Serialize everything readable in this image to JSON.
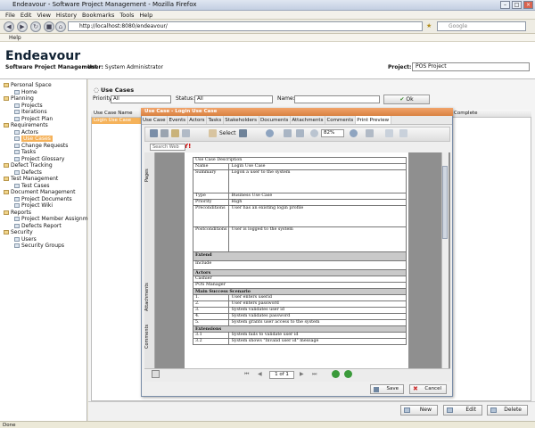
{
  "browser": {
    "title": "Endeavour - Software Project Management - Mozilla Firefox",
    "menu": [
      "File",
      "Edit",
      "View",
      "History",
      "Bookmarks",
      "Tools",
      "Help"
    ],
    "url": "http://localhost:8080/endeavour/",
    "search_placeholder": "Google",
    "help_label": "Help"
  },
  "app": {
    "logo": "Endeavour",
    "subtitle": "Software Project Management",
    "user_label": "User:",
    "user_value": "System Administrator",
    "project_label": "Project:",
    "project_value": "POS Project"
  },
  "sidebar": {
    "items": [
      {
        "label": "Personal Space",
        "level": 0
      },
      {
        "label": "Home",
        "level": 1
      },
      {
        "label": "Planning",
        "level": 0
      },
      {
        "label": "Projects",
        "level": 1
      },
      {
        "label": "Iterations",
        "level": 1
      },
      {
        "label": "Project Plan",
        "level": 1
      },
      {
        "label": "Requirements",
        "level": 0
      },
      {
        "label": "Actors",
        "level": 1
      },
      {
        "label": "Use Cases",
        "level": 1,
        "selected": true
      },
      {
        "label": "Change Requests",
        "level": 1
      },
      {
        "label": "Tasks",
        "level": 1
      },
      {
        "label": "Project Glossary",
        "level": 1
      },
      {
        "label": "Defect Tracking",
        "level": 0
      },
      {
        "label": "Defects",
        "level": 1
      },
      {
        "label": "Test Management",
        "level": 0
      },
      {
        "label": "Test Cases",
        "level": 1
      },
      {
        "label": "Document Management",
        "level": 0
      },
      {
        "label": "Project Documents",
        "level": 1
      },
      {
        "label": "Project Wiki",
        "level": 1
      },
      {
        "label": "Reports",
        "level": 0
      },
      {
        "label": "Project Member Assignments",
        "level": 1
      },
      {
        "label": "Defects Report",
        "level": 1
      },
      {
        "label": "Security",
        "level": 0
      },
      {
        "label": "Users",
        "level": 1
      },
      {
        "label": "Security Groups",
        "level": 1
      }
    ]
  },
  "main": {
    "title": "Use Cases",
    "priority_label": "Priority:",
    "priority_value": "All",
    "status_label": "Status:",
    "status_value": "All",
    "name_label": "Name:",
    "name_value": "",
    "ok_label": "Ok",
    "grid_col1": "Use Case Name",
    "grid_col_last": "Complete",
    "grid_row": "Login Use Case",
    "new_label": "New",
    "edit_label": "Edit",
    "delete_label": "Delete"
  },
  "dialog": {
    "title": "Use Case - Login Use Case",
    "tabs": [
      "Use Case",
      "Events",
      "Actors",
      "Tasks",
      "Stakeholders",
      "Documents",
      "Attachments",
      "Comments",
      "Print Preview"
    ],
    "active_tab": 8,
    "zoom": "82%",
    "select_label": "Select",
    "search_placeholder": "Search Web",
    "side_tabs": [
      "Pages",
      "Attachments",
      "Comments"
    ],
    "page_indicator": "1 of 1",
    "save_label": "Save",
    "cancel_label": "Cancel"
  },
  "document": {
    "heading": "Use Case Description",
    "rows": [
      {
        "k": "Name",
        "v": "Login Use Case"
      },
      {
        "k": "Summary",
        "v": "Logon a user to the system"
      },
      {
        "k": "Type",
        "v": "Business Use Case"
      },
      {
        "k": "Priority",
        "v": "High"
      },
      {
        "k": "Preconditions",
        "v": "User has an existing login profile"
      },
      {
        "k": "Postconditions",
        "v": "User is logged to the system"
      }
    ],
    "extend": "Extend",
    "include": "Include",
    "actors_heading": "Actors",
    "actors": [
      "Cashier",
      "POS Manager"
    ],
    "mss_heading": "Main Success Scenario",
    "mss": [
      {
        "n": "1.",
        "t": "User enters userid"
      },
      {
        "n": "2.",
        "t": "User enters password"
      },
      {
        "n": "3.",
        "t": "System validates user id"
      },
      {
        "n": "4.",
        "t": "System validates password"
      },
      {
        "n": "5.",
        "t": "System grants user access to the system"
      }
    ],
    "ext_heading": "Extensions",
    "ext": [
      {
        "n": "3.1",
        "t": "System fails to validate user id"
      },
      {
        "n": "3.2",
        "t": "System shows \"Invalid user id\" message"
      }
    ]
  },
  "status_text": "Done",
  "colors": {
    "accent": "#f5b25a",
    "dialog_title": "#d98141"
  }
}
